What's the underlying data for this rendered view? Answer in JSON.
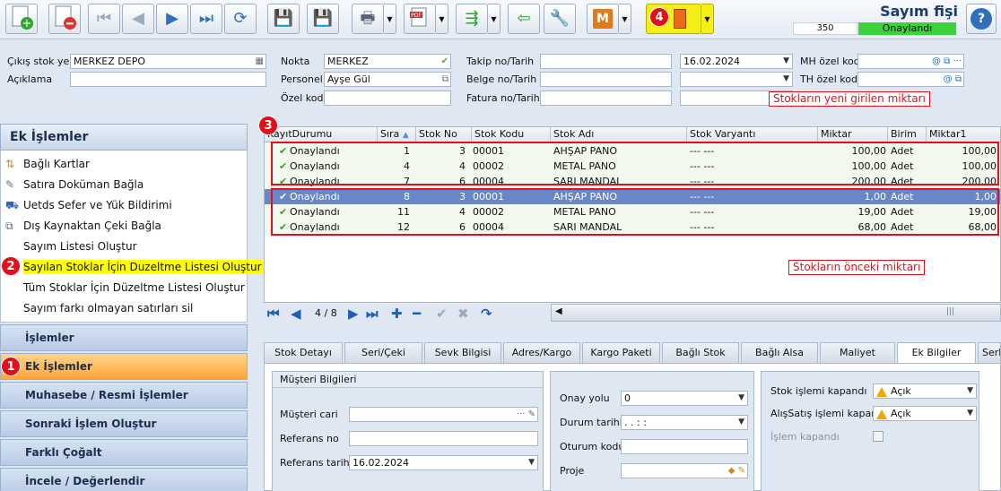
{
  "toolbar": {
    "title": "Sayım fişi",
    "count": "350",
    "status": "Onaylandı",
    "m_label": "M",
    "colors": {
      "accent_red": "#e0111b",
      "status_green": "#3cd23c",
      "highlight_yellow": "#ffff00"
    }
  },
  "badges": [
    "1",
    "2",
    "3",
    "4"
  ],
  "header": {
    "cikis_label": "Çıkış stok yeri",
    "cikis_value": "MERKEZ DEPO",
    "aciklama_label": "Açıklama",
    "aciklama_value": "",
    "nokta_label": "Nokta",
    "nokta_value": "MERKEZ",
    "personel_label": "Personel",
    "personel_value": "Ayşe Gül",
    "ozel_kod_label": "Özel kod",
    "ozel_kod_value": "",
    "takip_label": "Takip no/Tarih",
    "takip_value": "",
    "takip_date": "16.02.2024",
    "belge_label": "Belge no/Tarih",
    "belge_value": "",
    "fatura_label": "Fatura no/Tarih",
    "fatura_value": "",
    "mh_label": "MH özel kod",
    "mh_value": "",
    "th_label": "TH özel kod",
    "th_value": ""
  },
  "ek_islemler": {
    "title": "Ek İşlemler",
    "items": [
      {
        "label": "Bağlı Kartlar",
        "icon": "link-cards-icon"
      },
      {
        "label": "Satıra Doküman Bağla",
        "icon": "attach-document-icon"
      },
      {
        "label": "Uetds Sefer ve Yük Bildirimi",
        "icon": "truck-icon"
      },
      {
        "label": "Dış Kaynaktan Çeki Bağla",
        "icon": "copy-icon"
      },
      {
        "label": "Sayım Listesi Oluştur",
        "icon": ""
      },
      {
        "label": "Sayılan Stoklar İçin Duzeltme Listesi Oluştur",
        "icon": ""
      },
      {
        "label": "Tüm Stoklar İçin Düzeltme Listesi Oluştur",
        "icon": ""
      },
      {
        "label": "Sayım farkı olmayan satırları sil",
        "icon": ""
      }
    ]
  },
  "sections": [
    "İşlemler",
    "Ek İşlemler",
    "Muhasebe / Resmi İşlemler",
    "Sonraki İşlem Oluştur",
    "Farklı Çoğalt",
    "İncele / Değerlendir"
  ],
  "grid": {
    "columns": [
      "KayıtDurumu",
      "Sıra",
      "Stok No",
      "Stok Kodu",
      "Stok Adı",
      "Stok Varyantı",
      "Miktar",
      "Birim",
      "Miktar1"
    ],
    "rows": [
      {
        "durum": "Onaylandı",
        "sira": "1",
        "stok_no": "3",
        "stok_kodu": "00001",
        "stok_adi": "AHŞAP PANO",
        "varyant": "--- ---",
        "miktar": "100,00",
        "birim": "Adet",
        "miktar1": "100,00"
      },
      {
        "durum": "Onaylandı",
        "sira": "4",
        "stok_no": "4",
        "stok_kodu": "00002",
        "stok_adi": "METAL PANO",
        "varyant": "--- ---",
        "miktar": "100,00",
        "birim": "Adet",
        "miktar1": "100,00"
      },
      {
        "durum": "Onaylandı",
        "sira": "7",
        "stok_no": "6",
        "stok_kodu": "00004",
        "stok_adi": "SARI MANDAL",
        "varyant": "--- ---",
        "miktar": "200,00",
        "birim": "Adet",
        "miktar1": "200,00"
      },
      {
        "durum": "Onaylandı",
        "sira": "8",
        "stok_no": "3",
        "stok_kodu": "00001",
        "stok_adi": "AHŞAP PANO",
        "varyant": "--- ---",
        "miktar": "1,00",
        "birim": "Adet",
        "miktar1": "1,00"
      },
      {
        "durum": "Onaylandı",
        "sira": "11",
        "stok_no": "4",
        "stok_kodu": "00002",
        "stok_adi": "METAL PANO",
        "varyant": "--- ---",
        "miktar": "19,00",
        "birim": "Adet",
        "miktar1": "19,00"
      },
      {
        "durum": "Onaylandı",
        "sira": "12",
        "stok_no": "6",
        "stok_kodu": "00004",
        "stok_adi": "SARI MANDAL",
        "varyant": "--- ---",
        "miktar": "68,00",
        "birim": "Adet",
        "miktar1": "68,00"
      }
    ],
    "callout_new": "Stokların yeni girilen miktarı",
    "callout_old": "Stokların önceki miktarı"
  },
  "navigator": {
    "position": "4 / 8"
  },
  "tabs": [
    "Stok Detayı",
    "Seri/Çeki",
    "Sevk Bilgisi",
    "Adres/Kargo",
    "Kargo Paketi",
    "Bağlı Stok",
    "Bağlı Alsa",
    "Maliyet",
    "Ek Bilgiler",
    "Serb"
  ],
  "ek_bilgiler": {
    "musteri_group": "Müşteri Bilgileri",
    "musteri_cari_label": "Müşteri cari",
    "musteri_cari_value": "",
    "referans_no_label": "Referans no",
    "referans_no_value": "",
    "referans_tarihi_label": "Referans tarihi",
    "referans_tarihi_value": "16.02.2024",
    "onay_yolu_label": "Onay yolu",
    "onay_yolu_value": "0",
    "durum_tarihi_label": "Durum tarihi",
    "durum_tarihi_value": ".  .     :  :",
    "oturum_kodu_label": "Oturum kodu",
    "oturum_kodu_value": "",
    "proje_label": "Proje",
    "proje_value": "",
    "stok_islemi_label": "Stok işlemi kapandı",
    "stok_islemi_value": "Açık",
    "alis_satis_label": "AlışSatış işlemi kapandı",
    "alis_satis_value": "Açık",
    "islem_kapandi_label": "İşlem kapandı"
  }
}
